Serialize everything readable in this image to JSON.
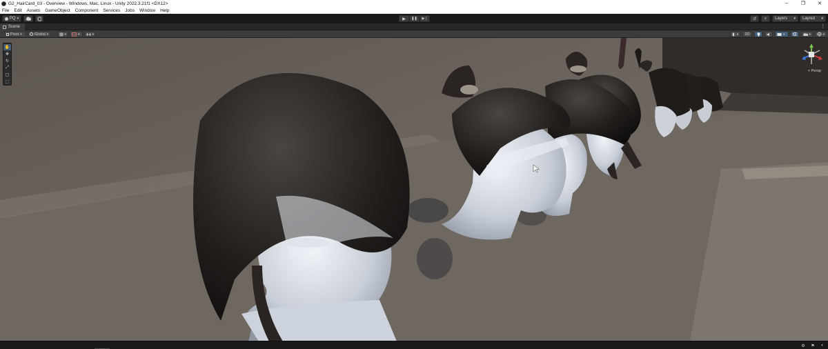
{
  "window": {
    "title": "G2_HairCard_03 - Overview - Windows, Mac, Linux - Unity 2022.3.21f1 <DX12>",
    "controls": {
      "minimize": "─",
      "maximize": "❐",
      "close": "✕"
    }
  },
  "menu": [
    "File",
    "Edit",
    "Assets",
    "GameObject",
    "Component",
    "Services",
    "Jobs",
    "Window",
    "Help"
  ],
  "toolbar": {
    "account_label": "PQ",
    "play_icons": {
      "play": "▶",
      "pause": "❚❚",
      "step": "▶❘"
    },
    "history_icon": "↺",
    "search_icon": "⌕",
    "layers_label": "Layers",
    "layout_label": "Layout"
  },
  "scene_tab": {
    "label": "Scene",
    "menu_icon": "⋮"
  },
  "scene_toolbar": {
    "pivot_label": "Pivot",
    "global_label": "Global",
    "mode_2d_label": "2D",
    "dropdown_arrow": "▾"
  },
  "tools": [
    "✋",
    "✥",
    "↻",
    "⤢",
    "▢",
    "⬚"
  ],
  "gizmo": {
    "view_label": "< Persp"
  },
  "status_icons": [
    "⚙",
    "⚑",
    "◐"
  ],
  "colors": {
    "editor_bg": "#191919",
    "panel": "#3c3c3c",
    "accent": "#46607c",
    "gizmo_x": "#d23c3c",
    "gizmo_y": "#7bc34a",
    "gizmo_z": "#3c78d8"
  }
}
